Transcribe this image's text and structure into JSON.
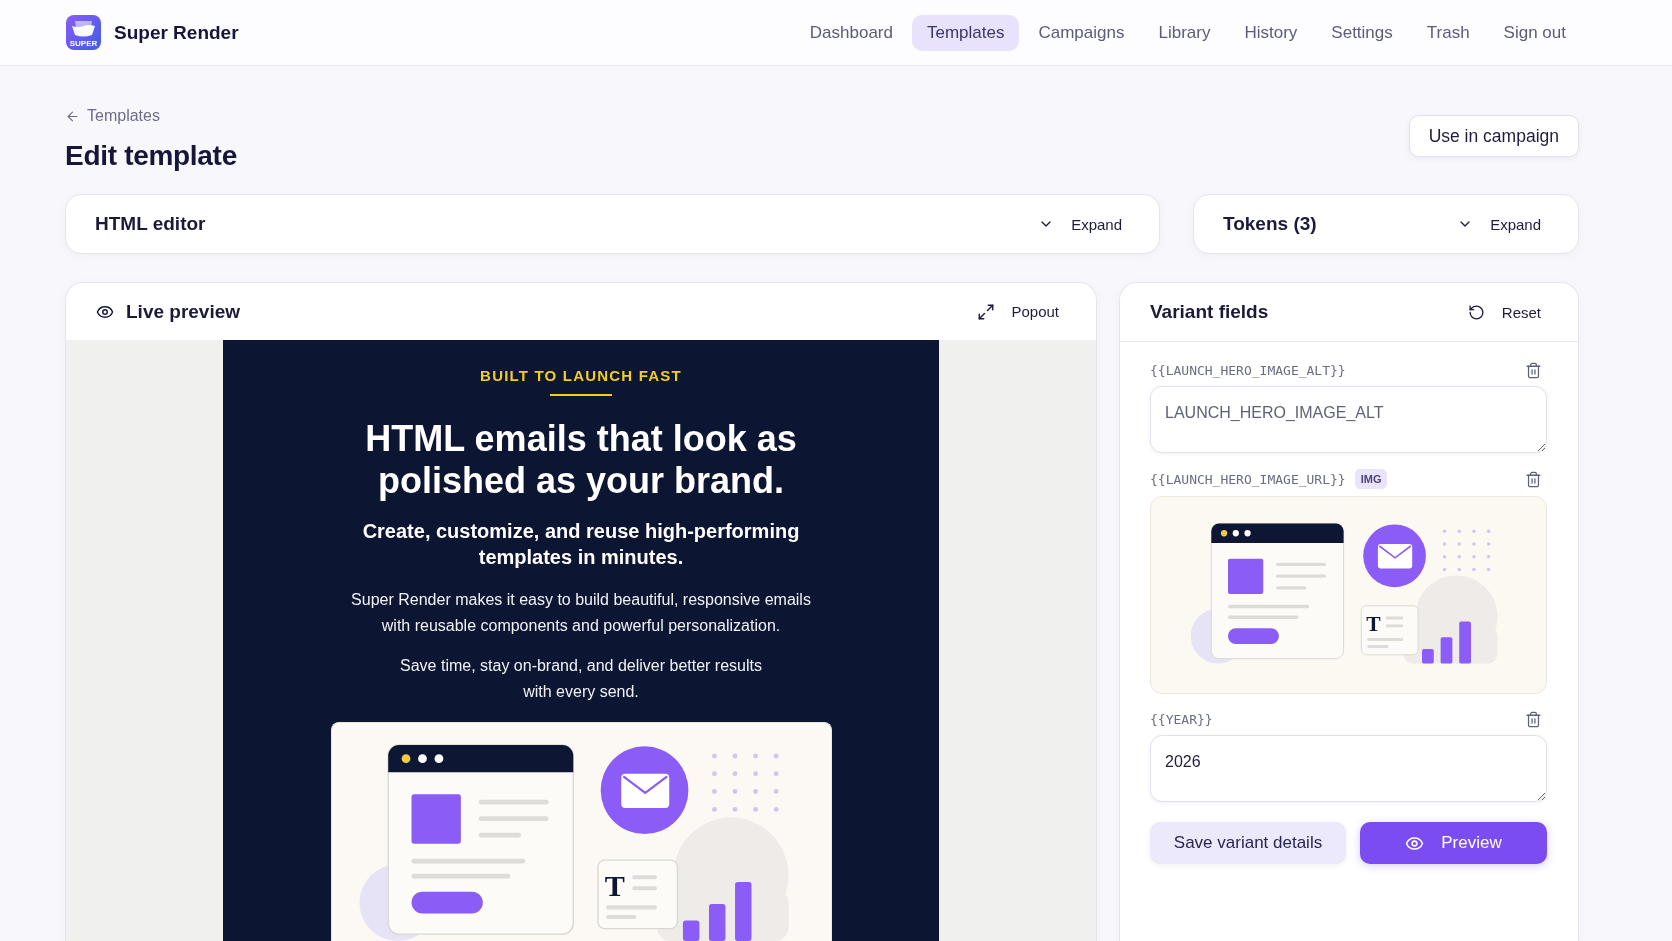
{
  "app": {
    "name": "Super Render",
    "logo_text": "SUPER"
  },
  "nav": [
    {
      "label": "Dashboard",
      "selected": false
    },
    {
      "label": "Templates",
      "selected": true
    },
    {
      "label": "Campaigns",
      "selected": false
    },
    {
      "label": "Library",
      "selected": false
    },
    {
      "label": "History",
      "selected": false
    },
    {
      "label": "Settings",
      "selected": false
    },
    {
      "label": "Trash",
      "selected": false
    },
    {
      "label": "Sign out",
      "selected": false
    }
  ],
  "breadcrumb": "Templates",
  "page_title": "Edit template",
  "header_button": "Use in campaign",
  "collapsibles": [
    {
      "title": "HTML editor",
      "action": "Expand",
      "expanded": false
    },
    {
      "title": "Tokens (3)",
      "action": "Expand",
      "expanded": false
    }
  ],
  "live_preview": {
    "title": "Live preview",
    "action": "Popout",
    "email": {
      "eyebrow": "BUILT TO LAUNCH FAST",
      "headline": "HTML emails that look as polished as your brand.",
      "subheadline": "Create, customize, and reuse high-performing templates in minutes.",
      "paragraphs": [
        "Super Render makes it easy to build beautiful, responsive emails with reusable components and powerful personalization.",
        "Save time, stay on-brand, and deliver better results with every send."
      ],
      "image_glyph": "T"
    }
  },
  "variant_fields": {
    "title": "Variant fields",
    "action": "Reset",
    "fields": [
      {
        "kind": "text",
        "token": "{{LAUNCH_HERO_IMAGE_ALT}}",
        "placeholder": "LAUNCH_HERO_IMAGE_ALT"
      },
      {
        "kind": "image",
        "token": "{{LAUNCH_HERO_IMAGE_URL}}",
        "badge": "IMG",
        "image_glyph": "T"
      },
      {
        "kind": "text",
        "token": "{{YEAR}}",
        "value": "2026"
      }
    ],
    "buttons": [
      {
        "kind": "secondary",
        "label": "Save variant details"
      },
      {
        "kind": "primary",
        "label": "Preview"
      }
    ]
  }
}
